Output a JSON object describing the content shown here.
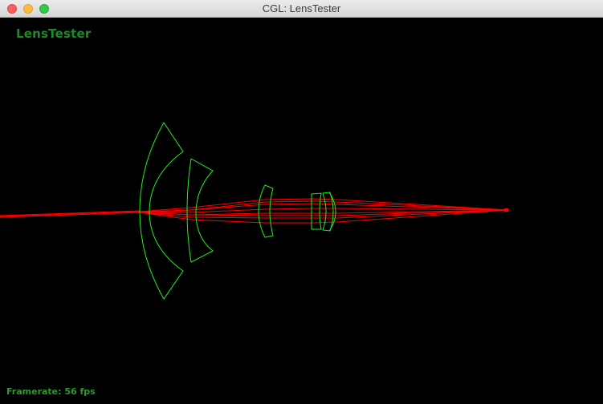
{
  "window": {
    "title": "CGL: LensTester",
    "controls": {
      "close": "close-icon",
      "minimize": "minimize-icon",
      "maximize": "maximize-icon"
    }
  },
  "app": {
    "label": "LensTester",
    "status": "Framerate: 56 fps"
  },
  "colors": {
    "background": "#000000",
    "lens_outline": "#22ee22",
    "ray": "#ff0000",
    "label": "#1f8a2a"
  }
}
